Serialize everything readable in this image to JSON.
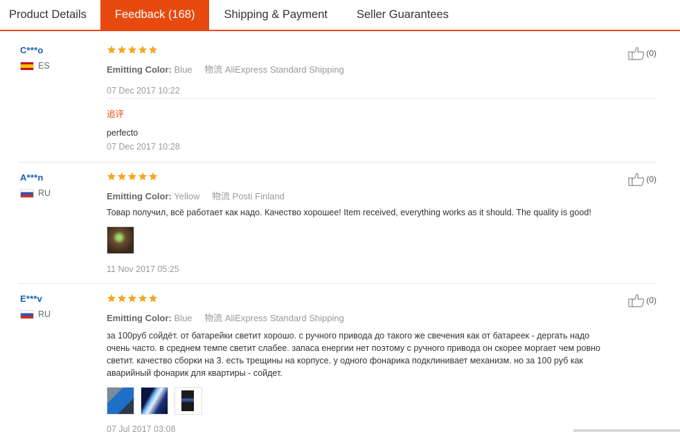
{
  "tabs": [
    {
      "label": "Product Details"
    },
    {
      "label": "Feedback (168)"
    },
    {
      "label": "Shipping & Payment"
    },
    {
      "label": "Seller Guarantees"
    }
  ],
  "labels": {
    "emitting_color": "Emitting Color:",
    "logistics": "物流"
  },
  "reviews": [
    {
      "user": "C***o",
      "country": "ES",
      "rating": 5,
      "color": "Blue",
      "shipping": "AliExpress Standard Shipping",
      "date": "07 Dec 2017 10:22",
      "likes": "(0)",
      "followup_label": "追评",
      "followup_text": "perfecto",
      "followup_date": "07 Dec 2017 10:28"
    },
    {
      "user": "A***n",
      "country": "RU",
      "rating": 5,
      "color": "Yellow",
      "shipping": "Posti Finland",
      "text": "Товар получил, всё работает как надо. Качество хорошее! Item received, everything works as it should. The quality is good!",
      "date": "11 Nov 2017 05:25",
      "likes": "(0)"
    },
    {
      "user": "E***v",
      "country": "RU",
      "rating": 5,
      "color": "Blue",
      "shipping": "AliExpress Standard Shipping",
      "text_lines": [
        "за 100руб сойдёт. от батарейки светит хорошо. с ручного привода до такого же свечения как от батареек - дергать надо",
        "очень часто. в среднем темпе светит слабее. запаса енергии нет поэтому с ручного привода он скорее моргает чем ровно",
        "светит. качество сборки на 3. есть трещины на корпусе. у одного фонарика подклинивает механизм. но за 100 руб как",
        "аварийный фонарик для квартиры - сойдет."
      ],
      "date": "07 Jul 2017 03:08",
      "likes": "(0)"
    }
  ],
  "icons": {
    "star": "star-icon",
    "like": "thumbs-up-icon",
    "flag_es": "spain-flag-icon",
    "flag_ru": "russia-flag-icon"
  },
  "colors": {
    "accent": "#e8490f",
    "star": "#f5a623",
    "username": "#1a5fb4"
  }
}
